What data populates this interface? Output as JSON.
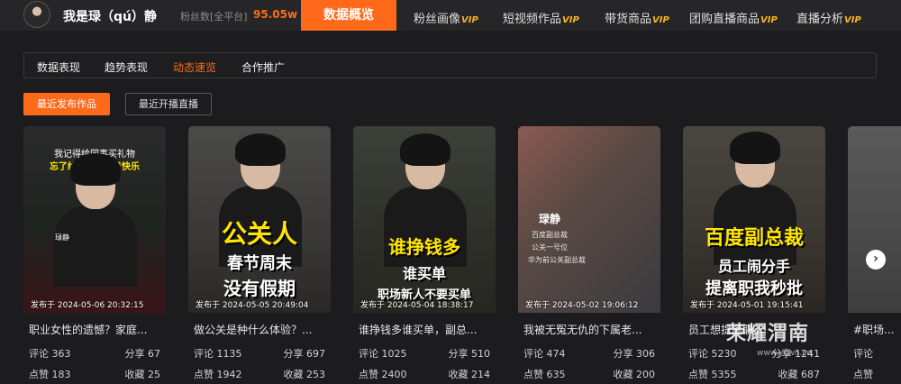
{
  "header": {
    "user_name": "我是琭（qú）静",
    "fans_label": "粉丝数[全平台]",
    "fans_value": "95.05w",
    "tabs": [
      {
        "label": "数据概览",
        "vip": ""
      },
      {
        "label": "粉丝画像",
        "vip": "VIP"
      },
      {
        "label": "短视频作品",
        "vip": "VIP"
      },
      {
        "label": "带货商品",
        "vip": "VIP"
      },
      {
        "label": "团购直播商品",
        "vip": "VIP"
      },
      {
        "label": "直播分析",
        "vip": "VIP"
      }
    ]
  },
  "subtabs": [
    "数据表现",
    "趋势表现",
    "动态速览",
    "合作推广"
  ],
  "active_subtab": "动态速览",
  "filters": {
    "recent_works": "最近发布作品",
    "recent_live": "最近开播直播"
  },
  "cards": [
    {
      "overlay_lines": [
        "我记得给同事买礼物",
        "忘了给儿子过生日快乐",
        "琭静"
      ],
      "date": "发布于 2024-05-06 20:32:15",
      "title": "职业女性的遗憾？家庭...",
      "comments": "评论 363",
      "shares": "分享 67",
      "likes": "点赞 183",
      "favorites": "收藏 25"
    },
    {
      "overlay_lines": [
        "公关人",
        "春节周末",
        "没有假期"
      ],
      "date": "发布于 2024-05-05 20:49:04",
      "title": "做公关是种什么体验？...",
      "comments": "评论 1135",
      "shares": "分享 697",
      "likes": "点赞 1942",
      "favorites": "收藏 253"
    },
    {
      "overlay_lines": [
        "谁挣钱多",
        "谁买单",
        "职场新人不要买单"
      ],
      "date": "发布于 2024-05-04 18:38:17",
      "title": "谁挣钱多谁买单，副总...",
      "comments": "评论 1025",
      "shares": "分享 510",
      "likes": "点赞 2400",
      "favorites": "收藏 214"
    },
    {
      "overlay_lines": [
        "琭静",
        "百度副总裁",
        "公关一号位",
        "华为前公关副总裁"
      ],
      "date": "发布于 2024-05-02 19:06:12",
      "title": "我被无冤无仇的下属老...",
      "comments": "评论 474",
      "shares": "分享 306",
      "likes": "点赞 635",
      "favorites": "收藏 200"
    },
    {
      "overlay_lines": [
        "百度副总裁",
        "员工闹分手",
        "提离职我秒批"
      ],
      "date": "发布于 2024-05-01 19:15:41",
      "title": "员工想提离职...",
      "comments": "评论 5230",
      "shares": "分享 1241",
      "likes": "点赞 5355",
      "favorites": "收藏 687"
    },
    {
      "overlay_lines": [],
      "date": "",
      "title": "#职场...",
      "comments": "评论",
      "shares": "",
      "likes": "点赞",
      "favorites": ""
    }
  ],
  "watermark": {
    "text": "荣耀渭南",
    "url": "www.ycwn.cn"
  },
  "colors": {
    "accent": "#ff6a1a",
    "vip": "#ffb31a",
    "overlay_yellow": "#ffe600",
    "background": "#1c1c1e"
  }
}
